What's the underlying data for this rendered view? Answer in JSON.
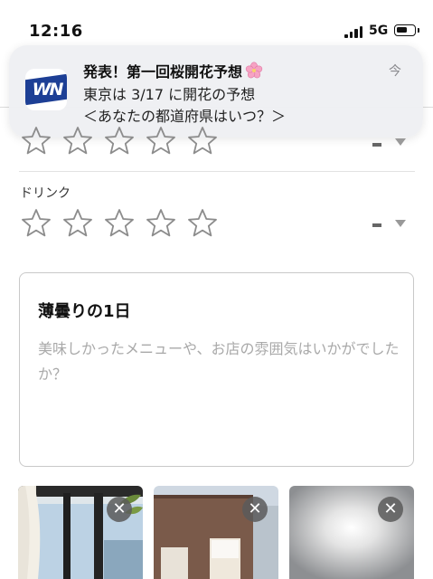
{
  "status_bar": {
    "time": "12:16",
    "network": "5G"
  },
  "notification": {
    "app_icon_text": "WN",
    "title": "発表！第一回桜開花予想",
    "line1": "東京は 3/17 に開花の予想",
    "line2": "＜あなたの都道府県はいつ？＞",
    "time": "今"
  },
  "ratings": [
    {
      "label": "",
      "stars": 5,
      "filled": 0,
      "value": "-"
    },
    {
      "label": "ドリンク",
      "stars": 5,
      "filled": 0,
      "value": "-"
    }
  ],
  "review": {
    "title": "薄曇りの1日",
    "placeholder": "美味しかったメニューや、お店の雰囲気はいかがでしたか？"
  },
  "photos": [
    {
      "name": "window-interior"
    },
    {
      "name": "restaurant-exterior"
    },
    {
      "name": "cloudy-sky"
    }
  ]
}
